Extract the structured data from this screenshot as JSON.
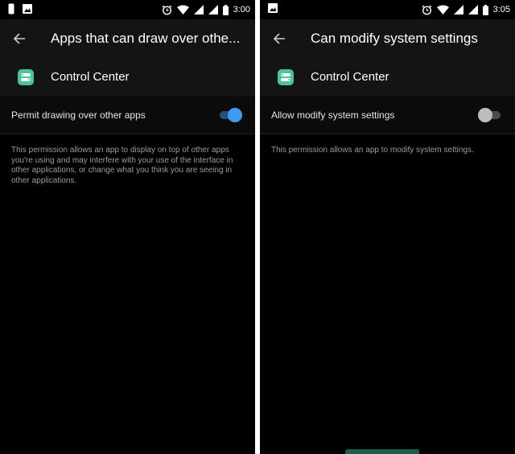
{
  "left_screen": {
    "status": {
      "time": "3:00"
    },
    "header": {
      "title": "Apps that can draw over othe..."
    },
    "app": {
      "name": "Control Center"
    },
    "setting": {
      "label": "Permit drawing over other apps",
      "enabled": true
    },
    "description": "This permission allows an app to display on top of other apps you're using and may interfere with your use of the interface in other applications, or change what you think you are seeing in other applications."
  },
  "right_screen": {
    "status": {
      "time": "3:05"
    },
    "header": {
      "title": "Can modify system settings"
    },
    "app": {
      "name": "Control Center"
    },
    "setting": {
      "label": "Allow modify system settings",
      "enabled": false
    },
    "description": "This permission allows an app to modify system settings."
  },
  "colors": {
    "app_icon": "#49c59a",
    "toggle_on": "#3d9cf0",
    "toggle_off": "#bdbdbd",
    "background": "#000000"
  },
  "icons": [
    "back-arrow-icon",
    "alarm-icon",
    "wifi-icon",
    "signal-icon",
    "battery-icon",
    "image-notification-icon",
    "control-center-app-icon"
  ]
}
